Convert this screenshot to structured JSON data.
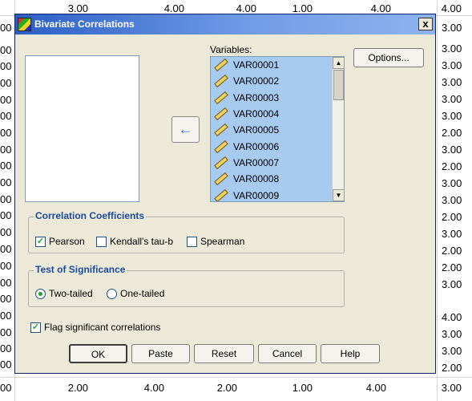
{
  "spreadsheet": {
    "top_row": [
      "3.00",
      "4.00",
      "4.00",
      "1.00",
      "4.00",
      "4.00"
    ],
    "bottom_row": [
      "2.00",
      "4.00",
      "2.00",
      "1.00",
      "4.00",
      "3.00"
    ],
    "left_col": [
      "00",
      "00",
      "00",
      "00",
      "00",
      "00",
      "00",
      "00",
      "00",
      "00",
      "00",
      "00",
      "00",
      "00",
      "00",
      "00",
      "00",
      "00",
      "00",
      "00",
      "00",
      "00"
    ],
    "right_col": [
      "3.00",
      "3.00",
      "3.00",
      "3.00",
      "3.00",
      "3.00",
      "2.00",
      "3.00",
      "2.00",
      "3.00",
      "3.00",
      "2.00",
      "3.00",
      "2.00",
      "2.00",
      "3.00",
      "4.00",
      "3.00",
      "3.00",
      "2.00"
    ]
  },
  "dialog": {
    "title": "Bivariate Correlations",
    "close": "x",
    "variables_label": "Variables:",
    "variables": [
      "VAR00001",
      "VAR00002",
      "VAR00003",
      "VAR00004",
      "VAR00005",
      "VAR00006",
      "VAR00007",
      "VAR00008",
      "VAR00009"
    ],
    "move_arrow": "←",
    "options_button": "Options...",
    "coefficients": {
      "title": "Correlation Coefficients",
      "pearson": "Pearson",
      "pearson_checked": true,
      "kendall": "Kendall's tau-b",
      "kendall_checked": false,
      "spearman": "Spearman",
      "spearman_checked": false
    },
    "significance": {
      "title": "Test of Significance",
      "two_tailed": "Two-tailed",
      "one_tailed": "One-tailed",
      "selected": "two_tailed"
    },
    "flag_label": "Flag significant correlations",
    "flag_checked": true,
    "buttons": {
      "ok": "OK",
      "paste": "Paste",
      "reset": "Reset",
      "cancel": "Cancel",
      "help": "Help"
    }
  }
}
